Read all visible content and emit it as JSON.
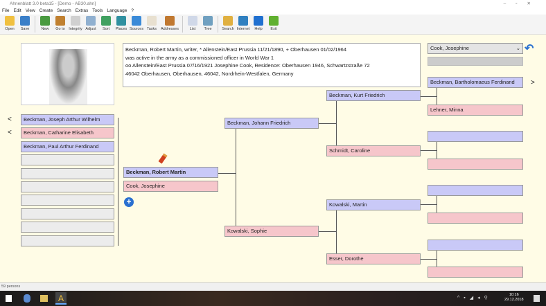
{
  "window": {
    "title": "Ahnenblatt 3.0 beta15 - [Demo - AB30.ahn]"
  },
  "menu": [
    "File",
    "Edit",
    "View",
    "Create",
    "Search",
    "Extras",
    "Tools",
    "Language",
    "?"
  ],
  "toolbar": [
    {
      "label": "Open",
      "color": "#f0c040"
    },
    {
      "label": "Save",
      "color": "#3a7fc8"
    },
    {
      "label": "New",
      "color": "#4a9a40"
    },
    {
      "label": "Go to",
      "color": "#c08030"
    },
    {
      "label": "Integrity",
      "color": "#d0d0d0"
    },
    {
      "label": "Adjust",
      "color": "#90b0d0"
    },
    {
      "label": "Sort",
      "color": "#40a060"
    },
    {
      "label": "Places",
      "color": "#3090a0"
    },
    {
      "label": "Sources",
      "color": "#3a8ad8"
    },
    {
      "label": "Tasks",
      "color": "#e8e0d0"
    },
    {
      "label": "Addresses",
      "color": "#c07830"
    },
    {
      "label": "List",
      "color": "#d0d8e8"
    },
    {
      "label": "Tree",
      "color": "#70a0c0"
    },
    {
      "label": "Search",
      "color": "#e0b040"
    },
    {
      "label": "Internet",
      "color": "#3080c0"
    },
    {
      "label": "Help",
      "color": "#2070d0"
    },
    {
      "label": "Exit",
      "color": "#60b030"
    }
  ],
  "info_text": [
    "Beckman, Robert Martin, writer, * Allenstein/East Prussia 11/21/1890, + Oberhausen 01/02/1964",
    "was active in the army as a commissioned officer in World War 1",
    "oo Allenstein/East Prussia 07/16/1921 Josephine Cook, Residence: Oberhausen 1946, Schwartzstraße 72",
    "46042 Oberhausen, Oberhausen, 46042, Nordrhein-Westfalen, Germany"
  ],
  "children": [
    "Beckman, Joseph Arthur Wilhelm",
    "Beckman, Catharine Elisabeth",
    "Beckman, Paul Arthur Ferdinand"
  ],
  "proband": "Beckman, Robert Martin",
  "spouse": "Cook, Josephine",
  "parents": {
    "father": "Beckman, Johann Friedrich",
    "mother": "Kowalski, Sophie"
  },
  "grandparents": [
    "Beckman, Kurt Friedrich",
    "Schmidt, Caroline",
    "Kowalski, Martin",
    "Esser, Dorothe"
  ],
  "great_grandparents": [
    "Beckman, Bartholomaeus Ferdinand",
    "Lehner, Minna",
    "",
    "",
    "",
    "",
    "",
    ""
  ],
  "spouse_select": "Cook, Josephine",
  "nav": {
    "back": "<",
    "forward": ">"
  },
  "status": "59 persons",
  "clock": {
    "time": "10:16",
    "date": "29.12.2018"
  }
}
